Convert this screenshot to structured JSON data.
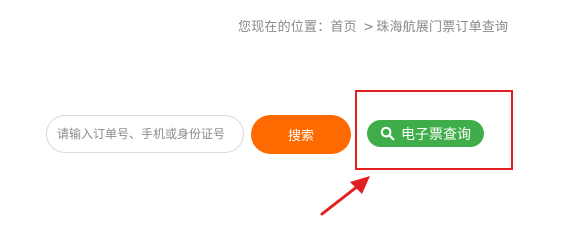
{
  "breadcrumb": {
    "prefix": "您现在的位置：",
    "home": "首页",
    "separator": ">",
    "current": "珠海航展门票订单查询"
  },
  "search": {
    "placeholder": "请输入订单号、手机或身份证号",
    "button_label": "搜索"
  },
  "eticket": {
    "button_label": "电子票查询",
    "icon": "search-icon"
  },
  "annotation": {
    "box_color": "#e02020",
    "arrow_color": "#e02020"
  },
  "colors": {
    "search_button": "#ff6a00",
    "eticket_button": "#3fae4a",
    "breadcrumb_text": "#8a8a8a"
  }
}
